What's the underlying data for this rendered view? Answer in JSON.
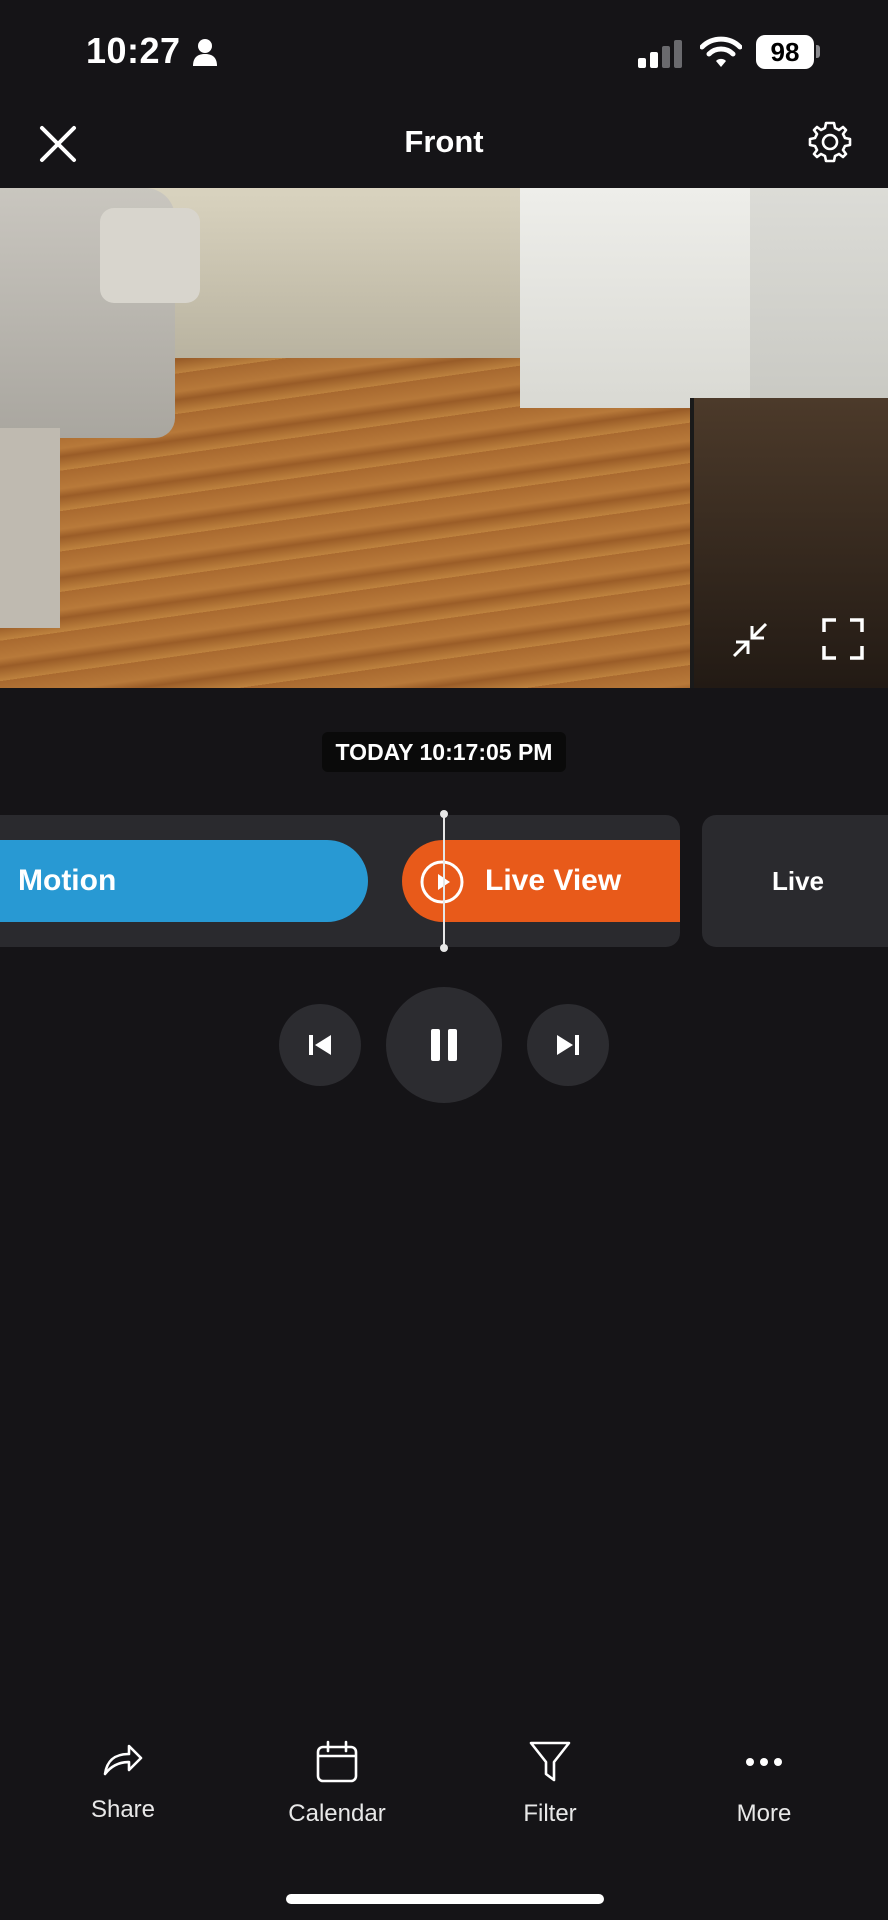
{
  "status_bar": {
    "time": "10:27",
    "battery": "98",
    "icons": [
      "person-icon",
      "signal-icon",
      "wifi-icon",
      "battery-icon"
    ]
  },
  "header": {
    "title": "Front",
    "left_icon": "close-icon",
    "right_icon": "gear-icon"
  },
  "camera": {
    "overlay_icons": [
      "collapse-icon",
      "fullscreen-icon"
    ]
  },
  "timestamp": "TODAY 10:17:05 PM",
  "timeline": {
    "events": [
      {
        "label": "Motion",
        "color": "#2899d3"
      },
      {
        "label": "Live View",
        "color": "#e85a1a",
        "icon": "play-circle-icon"
      },
      {
        "label": "Live",
        "color": "#2a2a2e"
      }
    ]
  },
  "playback": {
    "controls": [
      "skip-previous-icon",
      "pause-icon",
      "skip-next-icon"
    ]
  },
  "toolbar": {
    "items": [
      {
        "label": "Share",
        "icon": "share-icon"
      },
      {
        "label": "Calendar",
        "icon": "calendar-icon"
      },
      {
        "label": "Filter",
        "icon": "filter-icon"
      },
      {
        "label": "More",
        "icon": "more-icon"
      }
    ]
  },
  "colors": {
    "background": "#151417",
    "motion": "#2899d3",
    "live_view": "#e85a1a",
    "control_bg": "#2c2c30"
  }
}
